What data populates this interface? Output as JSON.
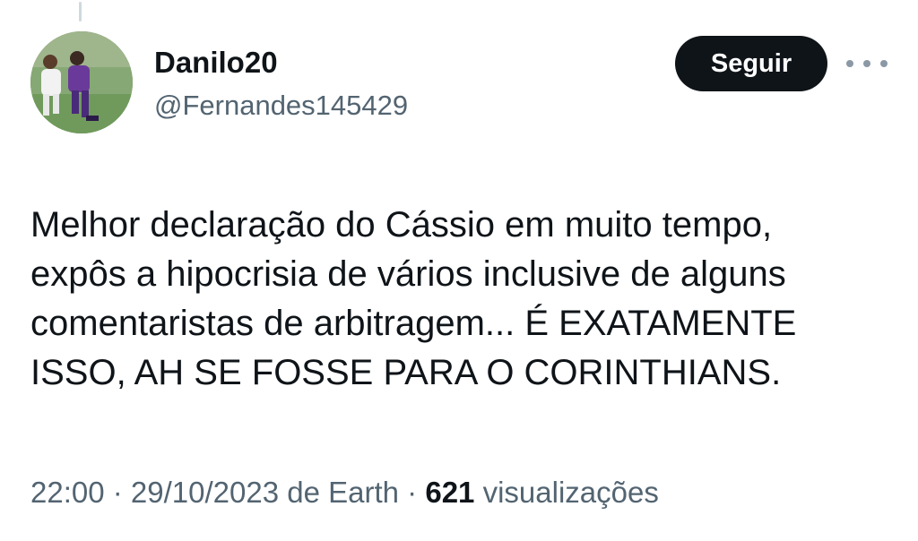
{
  "tweet": {
    "author": {
      "display_name": "Danilo20",
      "handle": "@Fernandes145429",
      "avatar_icon": "avatar-soccer-photo"
    },
    "follow_label": "Seguir",
    "more_icon": "more-options-icon",
    "text_lines": [
      "Melhor declaração do Cássio em muito tempo,",
      "expôs a hipocrisia de vários inclusive de alguns",
      "comentaristas de arbitragem... É EXATAMENTE",
      "ISSO, AH SE FOSSE PARA O CORINTHIANS."
    ],
    "meta": {
      "time": "22:00",
      "separator": " · ",
      "date": "29/10/2023 de Earth",
      "views_count": "621",
      "views_label": "visualizações"
    }
  },
  "colors": {
    "text": "#0f1419",
    "secondary_text": "#536471",
    "button_bg": "#0f1419",
    "button_text": "#ffffff",
    "thread_line": "#cfd9de"
  }
}
